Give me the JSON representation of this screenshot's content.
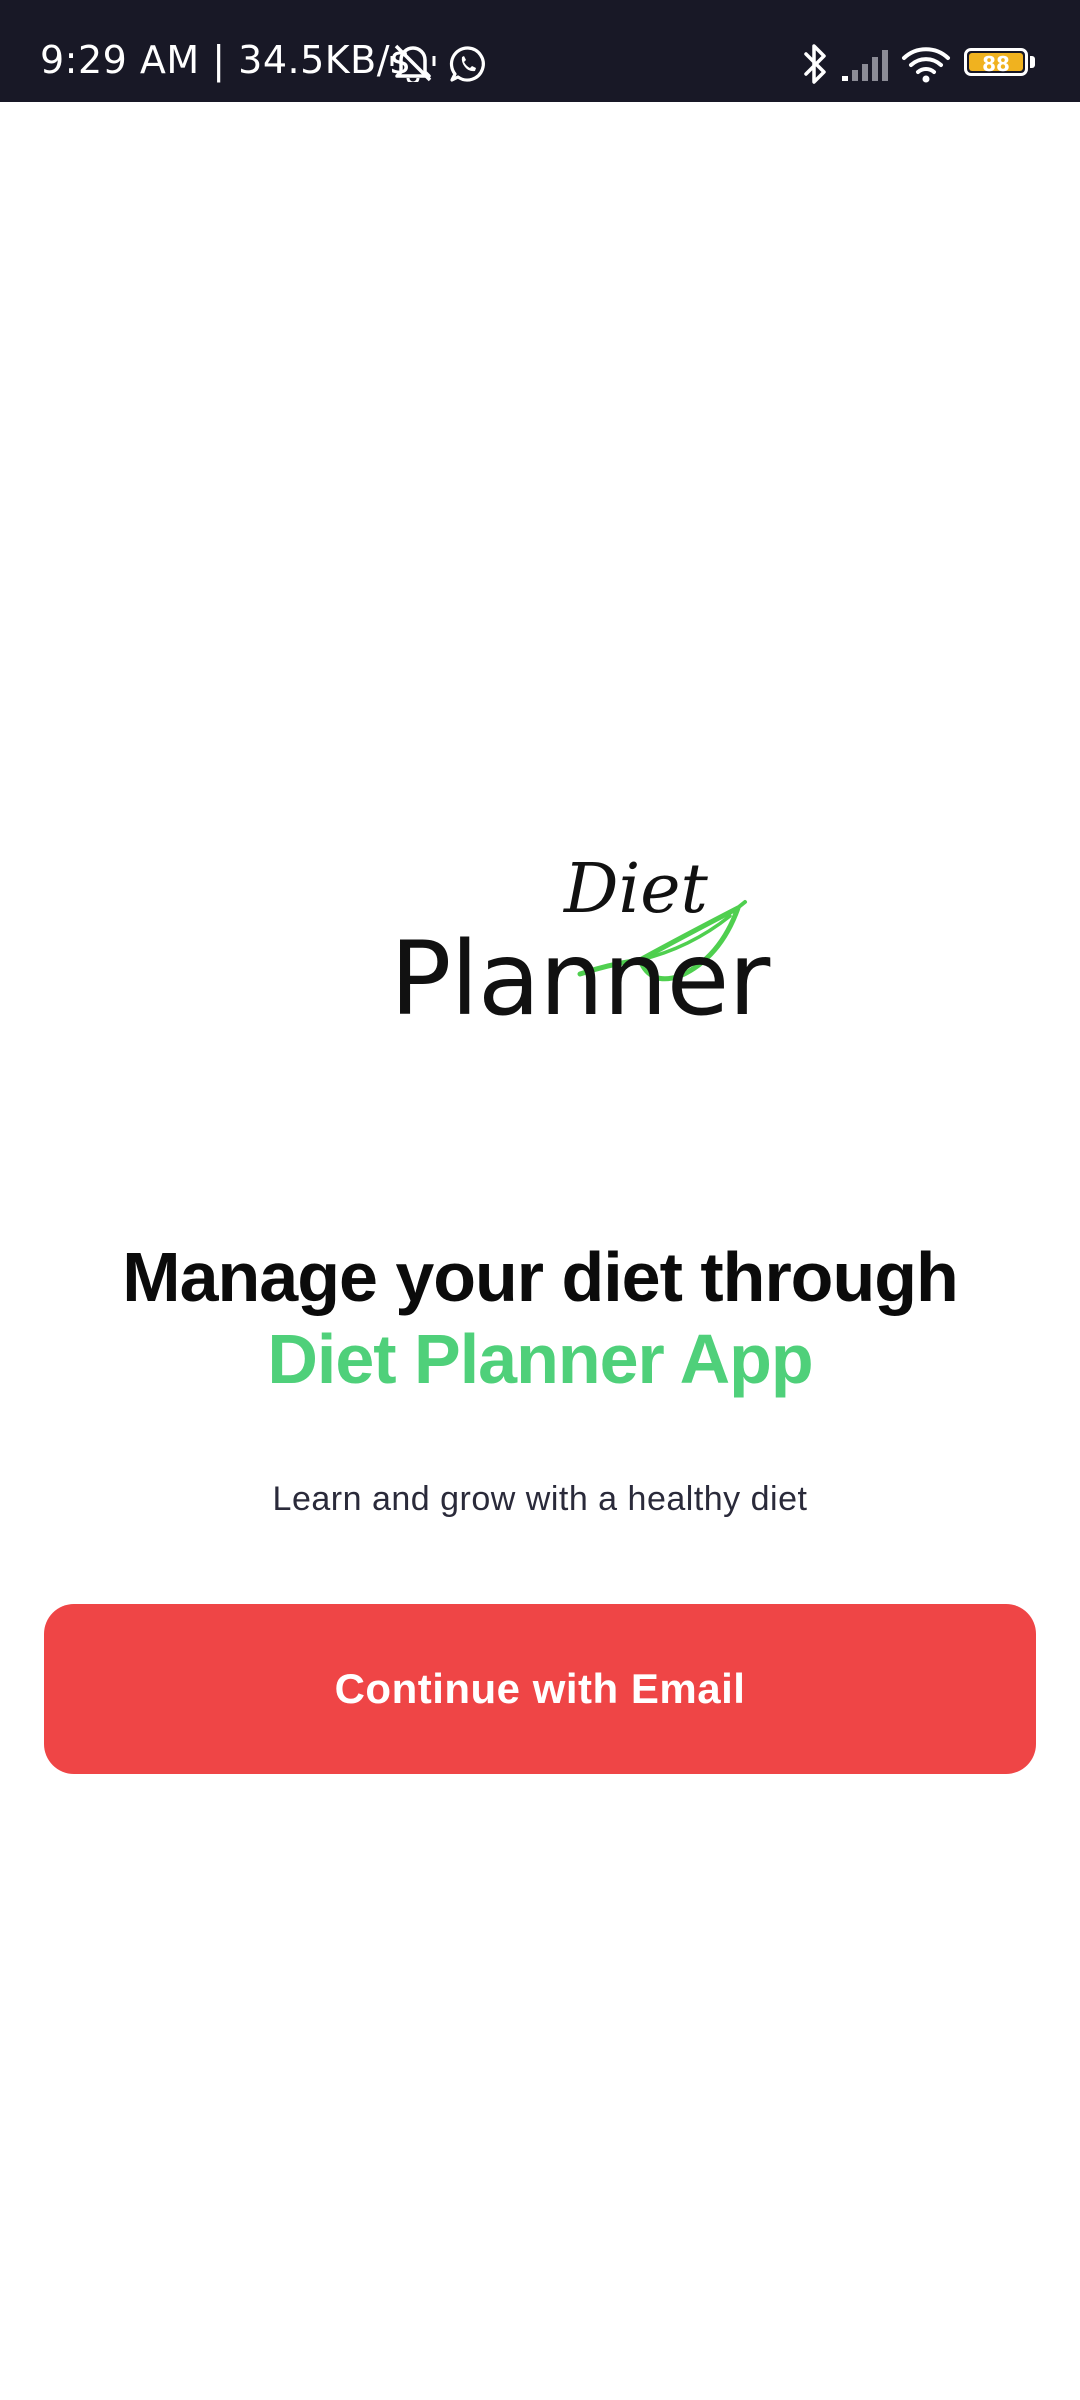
{
  "status_bar": {
    "time_and_speed": "9:29 AM | 34.5KB/s",
    "icons": [
      "alarm-off-icon",
      "whatsapp-icon",
      "bluetooth-icon",
      "signal-icon",
      "wifi-icon",
      "battery-icon"
    ],
    "battery_level": "88",
    "battery_color": "#f0b21f",
    "background": "#181826"
  },
  "logo": {
    "word_small": "Diet",
    "word_large": "Planner",
    "leaf_color": "#4fcf4f"
  },
  "headline": {
    "line1": "Manage your diet through",
    "line2": "Diet Planner App",
    "accent_color": "#4fd07a"
  },
  "subtitle": "Learn and grow with a healthy diet",
  "cta": {
    "label": "Continue with Email",
    "color": "#ef4546"
  }
}
